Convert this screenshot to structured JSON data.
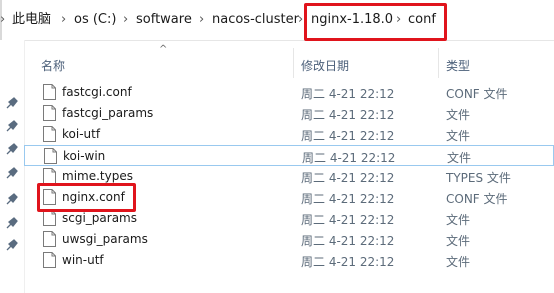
{
  "breadcrumb": {
    "items": [
      "此电脑",
      "os (C:)",
      "software",
      "nacos-cluster",
      "nginx-1.18.0",
      "conf"
    ],
    "separator": "›"
  },
  "columns": {
    "name": "名称",
    "date": "修改日期",
    "type": "类型"
  },
  "files": [
    {
      "name": "fastcgi.conf",
      "date": "周二 4-21 22:12",
      "type": "CONF 文件"
    },
    {
      "name": "fastcgi_params",
      "date": "周二 4-21 22:12",
      "type": "文件"
    },
    {
      "name": "koi-utf",
      "date": "周二 4-21 22:12",
      "type": "文件"
    },
    {
      "name": "koi-win",
      "date": "周二 4-21 22:12",
      "type": "文件"
    },
    {
      "name": "mime.types",
      "date": "周二 4-21 22:12",
      "type": "TYPES 文件"
    },
    {
      "name": "nginx.conf",
      "date": "周二 4-21 22:12",
      "type": "CONF 文件"
    },
    {
      "name": "scgi_params",
      "date": "周二 4-21 22:12",
      "type": "文件"
    },
    {
      "name": "uwsgi_params",
      "date": "周二 4-21 22:12",
      "type": "文件"
    },
    {
      "name": "win-utf",
      "date": "周二 4-21 22:12",
      "type": "文件"
    }
  ],
  "colors": {
    "highlight": "#e0141c",
    "selection": "#99c9ef"
  }
}
